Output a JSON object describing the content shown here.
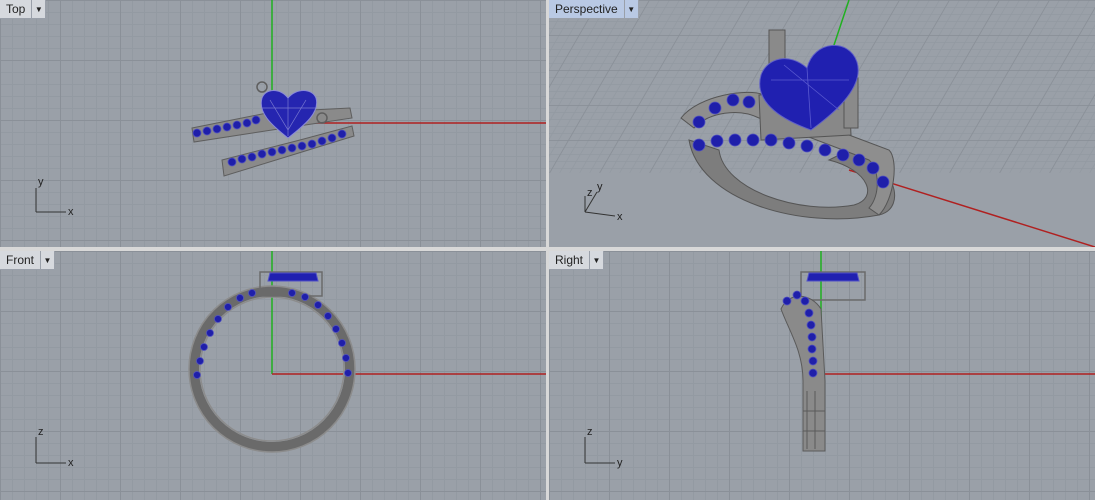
{
  "viewports": {
    "top": {
      "label": "Top",
      "axis_v": "y",
      "axis_h": "x"
    },
    "persp": {
      "label": "Perspective",
      "axis_v": "y",
      "axis_z": "z",
      "axis_h": "x"
    },
    "front": {
      "label": "Front",
      "axis_v": "z",
      "axis_h": "x"
    },
    "right": {
      "label": "Right",
      "axis_v": "z",
      "axis_h": "y"
    }
  },
  "colors": {
    "gem": "#1f1faa",
    "metal": "#6a6a6a",
    "axis_x": "#b02020",
    "axis_y": "#20b020"
  },
  "icons": {
    "menu": "dropdown-triangle-icon"
  }
}
